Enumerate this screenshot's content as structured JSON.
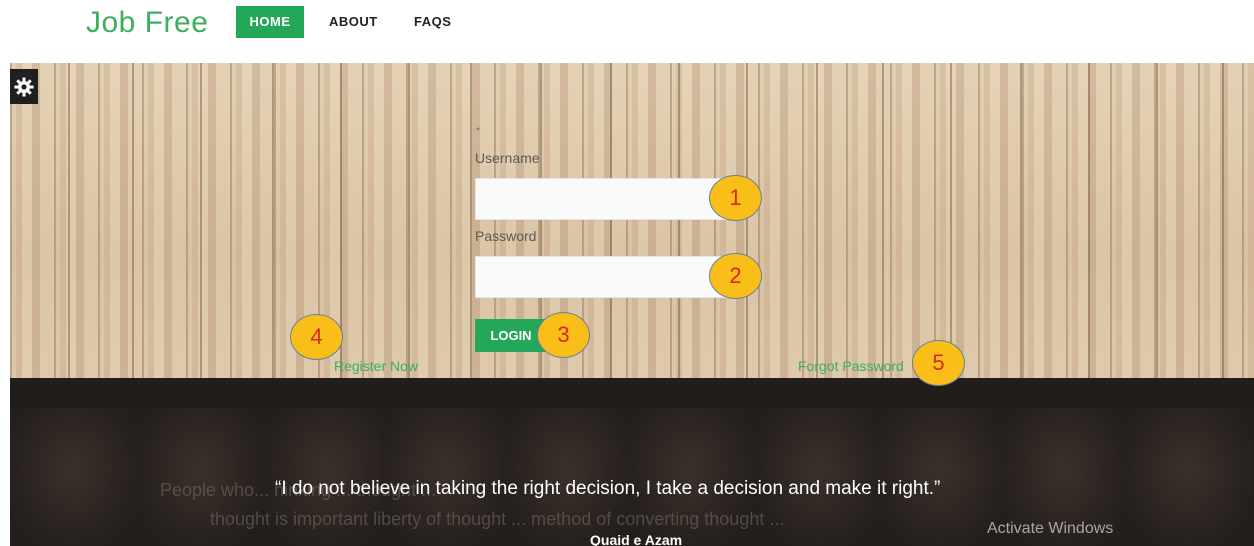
{
  "navbar": {
    "brand": "Job Free",
    "items": [
      {
        "label": "HOME",
        "active": true
      },
      {
        "label": "ABOUT",
        "active": false
      },
      {
        "label": "FAQS",
        "active": false
      }
    ]
  },
  "login_form": {
    "marker": "*",
    "username_label": "Username",
    "username_value": "",
    "password_label": "Password",
    "password_value": "",
    "login_button": "LOGIN",
    "register_link": "Register Now",
    "forgot_link": "Forgot Password"
  },
  "annotations": [
    "1",
    "2",
    "3",
    "4",
    "5"
  ],
  "quote_section": {
    "background_text_line1": "People who... hinking ... thought ...",
    "background_text_line2": "thought is important liberty of thought ... method of converting thought ...",
    "quote": "“I do not believe in taking the right decision, I take a decision and make it right.”",
    "author": "Quaid e Azam"
  },
  "watermark": "Activate Windows",
  "colors": {
    "brand_green": "#3cae5e",
    "button_green": "#25a75a",
    "badge_fill": "#f9be18",
    "badge_text": "#d62a1a",
    "dark_panel": "#2d2a28"
  },
  "icons": {
    "settings": "gear-icon"
  }
}
